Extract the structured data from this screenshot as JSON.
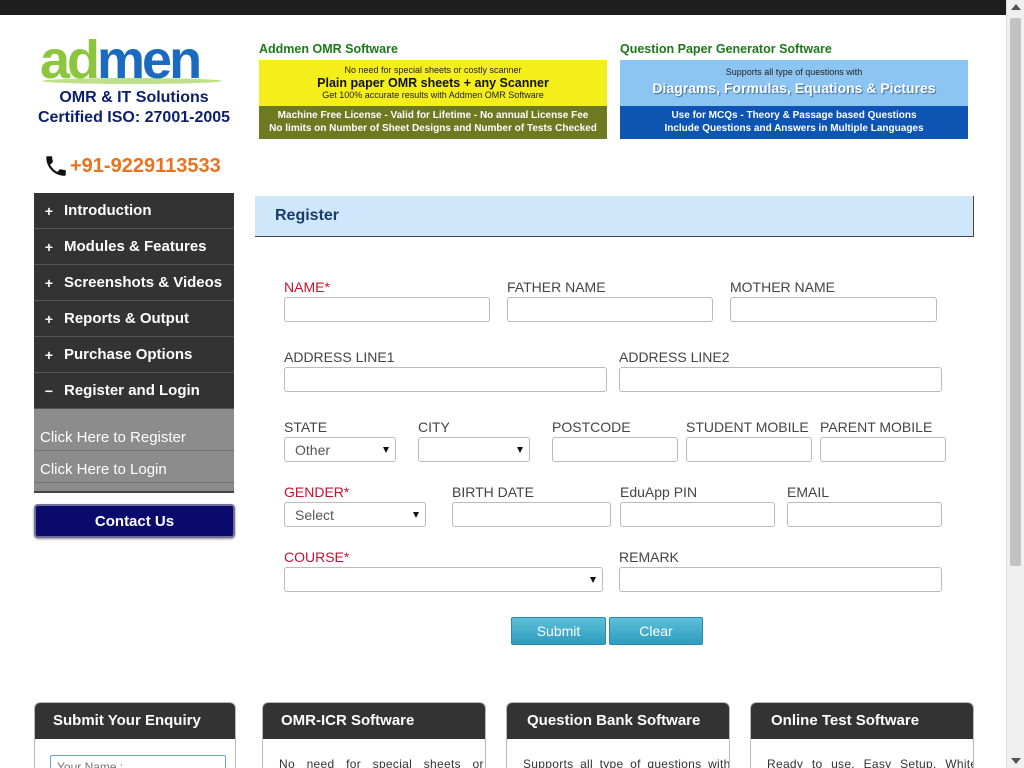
{
  "header": {
    "logo_part1": "ad",
    "logo_part2": "men",
    "tagline1": "OMR & IT Solutions",
    "tagline2": "Certified ISO: 27001-2005",
    "phone": "+91-9229113533"
  },
  "banners": {
    "omr": {
      "title": "Addmen OMR Software",
      "line1": "No need for special sheets or costly scanner",
      "line2": "Plain paper OMR sheets + any Scanner",
      "line3": "Get 100% accurate results with Addmen OMR Software",
      "line4": "Machine Free License - Valid for Lifetime - No annual License Fee",
      "line5": "No limits on Number of Sheet Designs and Number of Tests Checked"
    },
    "qp": {
      "title": "Question Paper Generator Software",
      "line1": "Supports all type of questions with",
      "line2": "Diagrams, Formulas, Equations & Pictures",
      "line3": "Use for MCQs - Theory & Passage based Questions",
      "line4": "Include Questions and Answers in Multiple Languages"
    }
  },
  "sidebar": {
    "items": [
      {
        "sign": "+",
        "label": "Introduction"
      },
      {
        "sign": "+",
        "label": "Modules & Features"
      },
      {
        "sign": "+",
        "label": "Screenshots & Videos"
      },
      {
        "sign": "+",
        "label": "Reports & Output"
      },
      {
        "sign": "+",
        "label": "Purchase Options"
      },
      {
        "sign": "−",
        "label": "Register and Login"
      }
    ],
    "sub_items": [
      {
        "label": "Click Here to Register"
      },
      {
        "label": "Click Here to Login"
      }
    ],
    "contact": "Contact Us"
  },
  "form": {
    "title": "Register",
    "labels": {
      "name": "NAME*",
      "father_name": "FATHER NAME",
      "mother_name": "MOTHER NAME",
      "address1": "ADDRESS LINE1",
      "address2": "ADDRESS LINE2",
      "state": "STATE",
      "city": "CITY",
      "postcode": "POSTCODE",
      "student_mobile": "STUDENT MOBILE",
      "parent_mobile": "PARENT MOBILE",
      "gender": "GENDER*",
      "birth_date": "BIRTH DATE",
      "eduapp_pin": "EduApp PIN",
      "email": "EMAIL",
      "course": "COURSE*",
      "remark": "REMARK"
    },
    "values": {
      "state": "Other",
      "city": "",
      "gender": "Select",
      "course": ""
    },
    "submit": "Submit",
    "clear": "Clear"
  },
  "bottom_boxes": [
    {
      "title": "Submit Your Enquiry",
      "placeholder": "Your Name :"
    },
    {
      "title": "OMR-ICR Software",
      "text": "No need for special sheets or"
    },
    {
      "title": "Question Bank Software",
      "text": "Supports all type of questions with"
    },
    {
      "title": "Online Test Software",
      "text": "Ready to use. Easy Setup. White"
    }
  ],
  "colors": {
    "accent_orange": "#e8731e",
    "navy": "#0b1f6b",
    "required_red": "#c8102e",
    "header_blue": "#cfe7fb"
  }
}
